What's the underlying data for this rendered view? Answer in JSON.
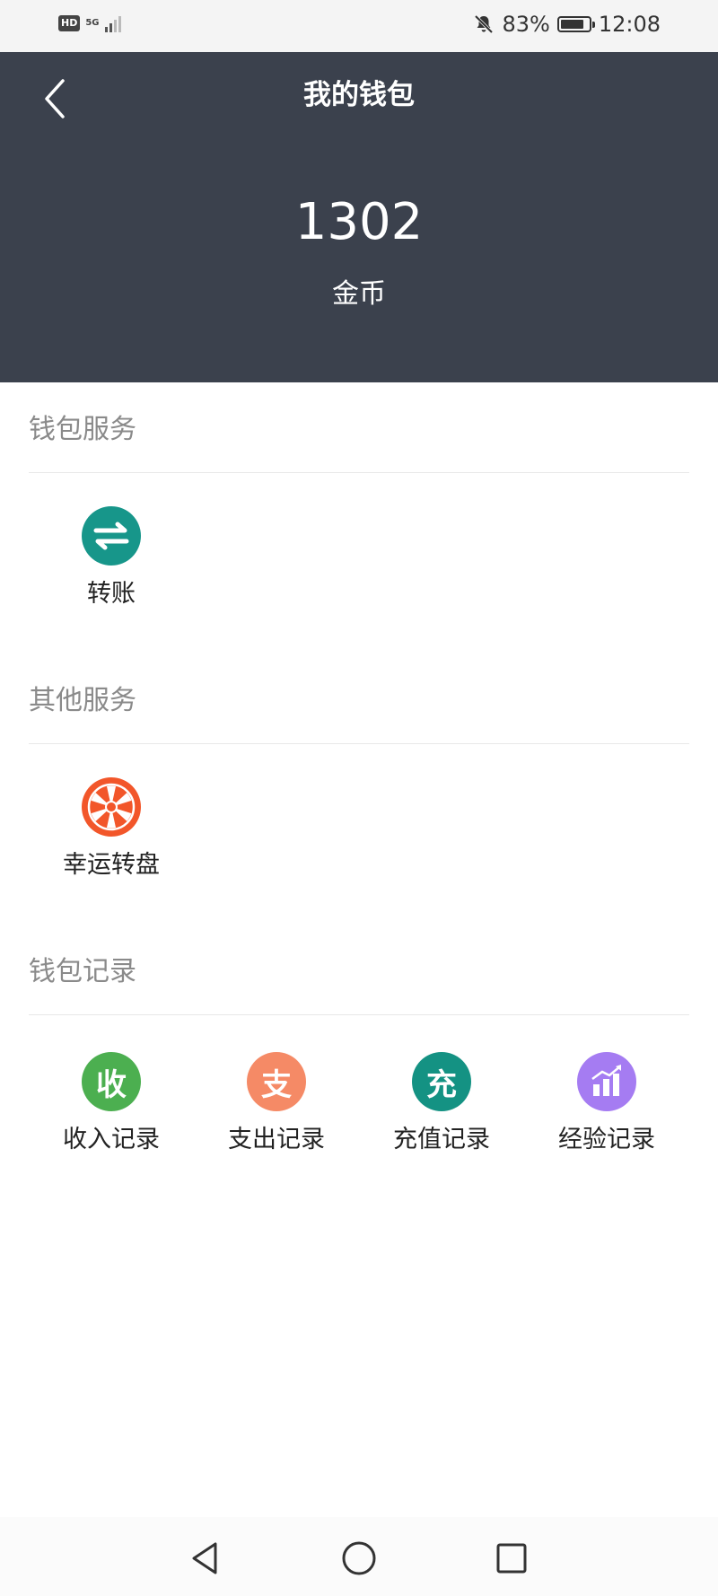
{
  "status_bar": {
    "hd": "HD",
    "network": "5G",
    "battery_percent": "83%",
    "battery_level": 0.83,
    "time": "12:08",
    "icons": [
      "mute-bell-icon",
      "battery-icon",
      "signal-icon"
    ]
  },
  "header": {
    "title": "我的钱包",
    "balance": "1302",
    "unit": "金币",
    "background": "#3b414d"
  },
  "sections": {
    "wallet_services": {
      "title": "钱包服务",
      "items": [
        {
          "label": "转账",
          "icon": "transfer-icon",
          "color": "#17968a"
        }
      ]
    },
    "other_services": {
      "title": "其他服务",
      "items": [
        {
          "label": "幸运转盘",
          "icon": "lucky-wheel-icon",
          "color": "#f2562a"
        }
      ]
    },
    "wallet_records": {
      "title": "钱包记录",
      "items": [
        {
          "label": "收入记录",
          "glyph": "收",
          "icon": "income-icon",
          "color": "#4caf50"
        },
        {
          "label": "支出记录",
          "glyph": "支",
          "icon": "expense-icon",
          "color": "#f58a66"
        },
        {
          "label": "充值记录",
          "glyph": "充",
          "icon": "recharge-icon",
          "color": "#149283"
        },
        {
          "label": "经验记录",
          "icon": "experience-chart-icon",
          "color": "#a57cf2"
        }
      ]
    }
  },
  "nav_bar": {
    "icons": [
      "back-triangle-icon",
      "home-circle-icon",
      "recents-square-icon"
    ]
  }
}
